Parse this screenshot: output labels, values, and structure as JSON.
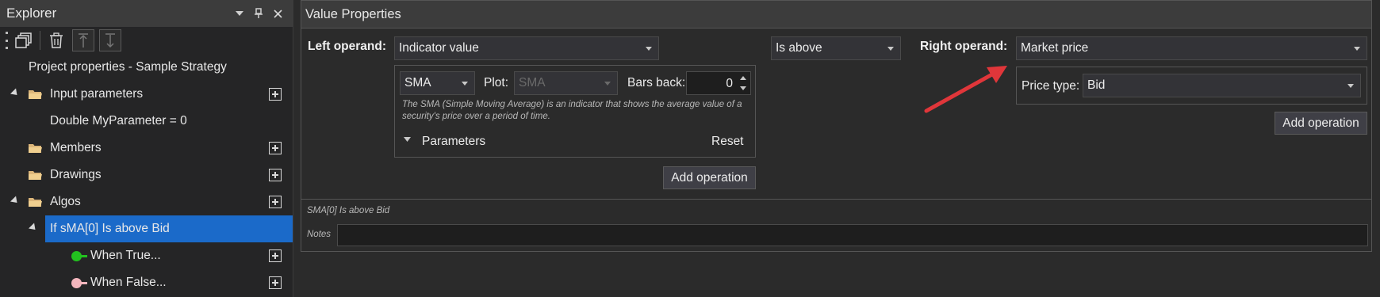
{
  "explorer": {
    "title": "Explorer",
    "header_icons": [
      "dropdown-icon",
      "pin-icon",
      "close-icon"
    ],
    "toolbar": [
      "grip-icon",
      "copy-icon",
      "delete-icon",
      "move-up-icon",
      "move-down-icon"
    ],
    "tree": {
      "project": "Project properties - Sample Strategy",
      "input_parameters": "Input parameters",
      "parameter_item": "Double MyParameter = 0",
      "members": "Members",
      "drawings": "Drawings",
      "algos": "Algos",
      "algo_item": "If sMA[0] Is above Bid",
      "when_true": "When True...",
      "when_false": "When False..."
    },
    "colors": {
      "selected": "#1b6ac9",
      "true_dot": "#22c11f",
      "false_dot": "#f4b6bd"
    }
  },
  "value_properties": {
    "title": "Value Properties",
    "left_operand_label": "Left operand:",
    "left_operand_value": "Indicator value",
    "comparator": "Is above",
    "right_operand_label": "Right operand:",
    "right_operand_value": "Market price",
    "indicator": "SMA",
    "plot_label": "Plot:",
    "plot_value": "SMA",
    "bars_back_label": "Bars back:",
    "bars_back_value": "0",
    "description": "The SMA (Simple Moving Average) is an indicator that shows the average value of a security's price over a period of time.",
    "parameters_label": "Parameters",
    "reset_label": "Reset",
    "add_operation_left": "Add operation",
    "price_type_label": "Price type:",
    "price_type_value": "Bid",
    "add_operation_right": "Add operation",
    "summary": "SMA[0] Is above Bid",
    "notes_label": "Notes",
    "notes_value": ""
  },
  "annotation_arrow_color": "#e0363a"
}
